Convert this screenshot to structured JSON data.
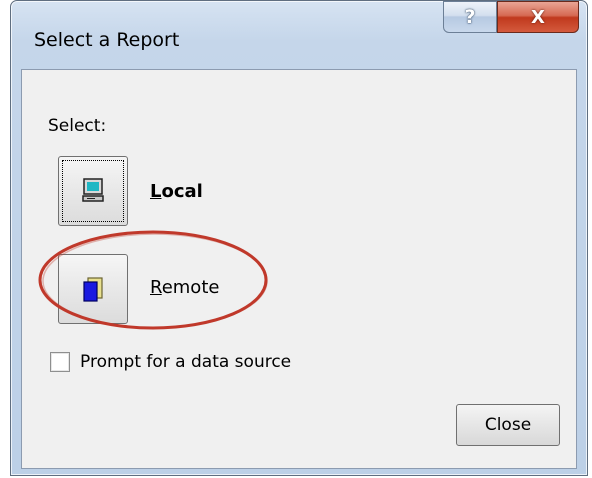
{
  "window": {
    "title": "Select a Report",
    "help_button": "?",
    "close_button": "X"
  },
  "dialog": {
    "select_label": "Select:",
    "local": {
      "mnemonic": "L",
      "rest": "ocal",
      "icon": "computer-icon"
    },
    "remote": {
      "mnemonic": "R",
      "rest": "emote",
      "icon": "remote-folder-icon"
    },
    "prompt_checkbox": {
      "label": "Prompt for a data source",
      "checked": false
    },
    "close_label": "Close"
  },
  "annotation": {
    "color": "#c0392b",
    "target": "remote"
  },
  "colors": {
    "title_bar": "#c5d6ea",
    "client_bg": "#f0f0f0",
    "close_x_red": "#c0391d"
  }
}
